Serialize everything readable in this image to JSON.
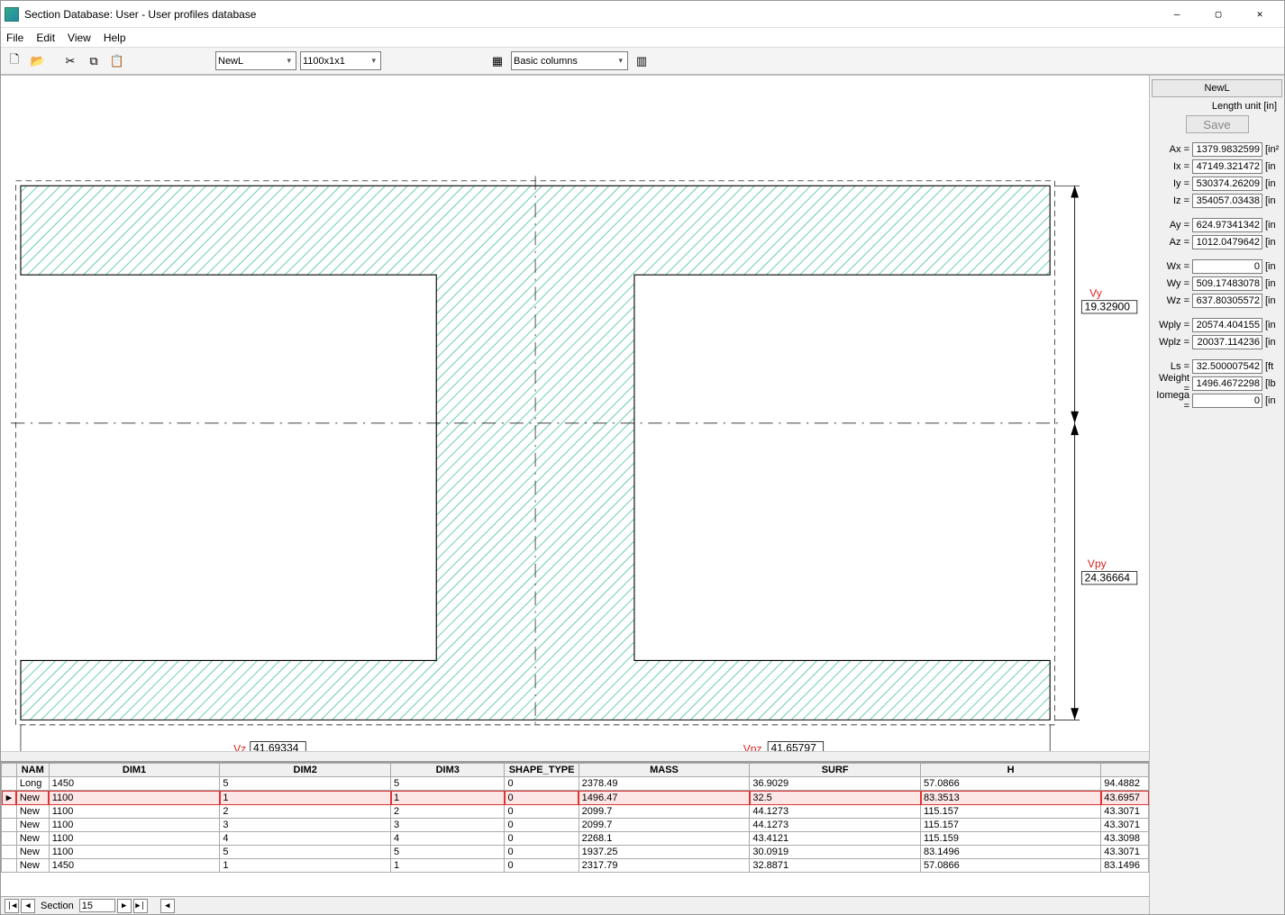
{
  "window": {
    "title": "Section Database: User - User profiles database"
  },
  "menu": {
    "file": "File",
    "edit": "Edit",
    "view": "View",
    "help": "Help"
  },
  "toolbar": {
    "combo1": "NewL",
    "combo2": "1100x1x1",
    "combo3": "Basic columns"
  },
  "drawing": {
    "vz_label": "Vz",
    "vz": "41.69334",
    "vpz_label": "Vpz",
    "vpz": "41.65797",
    "vy_label": "Vy",
    "vy": "19.32900",
    "vpy_label": "Vpy",
    "vpy": "24.36664"
  },
  "props": {
    "header": "NewL",
    "length_unit": "Length unit   [in]",
    "save": "Save",
    "rows": [
      {
        "lab": "Ax =",
        "val": "1379.9832599",
        "unit": "[in²"
      },
      {
        "lab": "Ix =",
        "val": "47149.321472",
        "unit": "[in"
      },
      {
        "lab": "Iy =",
        "val": "530374.26209",
        "unit": "[in"
      },
      {
        "lab": "Iz =",
        "val": "354057.03438",
        "unit": "[in"
      },
      {
        "gap": true
      },
      {
        "lab": "Ay =",
        "val": "624.97341342",
        "unit": "[in"
      },
      {
        "lab": "Az =",
        "val": "1012.0479642",
        "unit": "[in"
      },
      {
        "gap": true
      },
      {
        "lab": "Wx =",
        "val": "0",
        "unit": "[in"
      },
      {
        "lab": "Wy =",
        "val": "509.17483078",
        "unit": "[in"
      },
      {
        "lab": "Wz =",
        "val": "637.80305572",
        "unit": "[in"
      },
      {
        "gap": true
      },
      {
        "lab": "Wply =",
        "val": "20574.404155",
        "unit": "[in"
      },
      {
        "lab": "Wplz =",
        "val": "20037.114236",
        "unit": "[in"
      },
      {
        "gap": true
      },
      {
        "lab": "Ls =",
        "val": "32.500007542",
        "unit": "[ft"
      },
      {
        "lab": "Weight =",
        "val": "1496.4672298",
        "unit": "[lb"
      },
      {
        "lab": "Iomega =",
        "val": "0",
        "unit": "[in"
      }
    ]
  },
  "table": {
    "columns": [
      "",
      "NAM",
      "DIM1",
      "DIM2",
      "DIM3",
      "SHAPE_TYPE",
      "MASS",
      "SURF",
      "H",
      ""
    ],
    "rows": [
      {
        "sel": false,
        "c": [
          "",
          "Long",
          "1450",
          "5",
          "5",
          "0",
          "2378.49",
          "36.9029",
          "57.0866",
          "94.4882"
        ]
      },
      {
        "sel": true,
        "c": [
          "▶",
          "New",
          "1100",
          "1",
          "1",
          "0",
          "1496.47",
          "32.5",
          "83.3513",
          "43.6957"
        ]
      },
      {
        "sel": false,
        "c": [
          "",
          "New",
          "1100",
          "2",
          "2",
          "0",
          "2099.7",
          "44.1273",
          "115.157",
          "43.3071"
        ]
      },
      {
        "sel": false,
        "c": [
          "",
          "New",
          "1100",
          "3",
          "3",
          "0",
          "2099.7",
          "44.1273",
          "115.157",
          "43.3071"
        ]
      },
      {
        "sel": false,
        "c": [
          "",
          "New",
          "1100",
          "4",
          "4",
          "0",
          "2268.1",
          "43.4121",
          "115.159",
          "43.3098"
        ]
      },
      {
        "sel": false,
        "c": [
          "",
          "New",
          "1100",
          "5",
          "5",
          "0",
          "1937.25",
          "30.0919",
          "83.1496",
          "43.3071"
        ]
      },
      {
        "sel": false,
        "c": [
          "",
          "New",
          "1450",
          "1",
          "1",
          "0",
          "2317.79",
          "32.8871",
          "57.0866",
          "83.1496"
        ]
      }
    ]
  },
  "nav": {
    "label": "Section",
    "value": "15"
  }
}
